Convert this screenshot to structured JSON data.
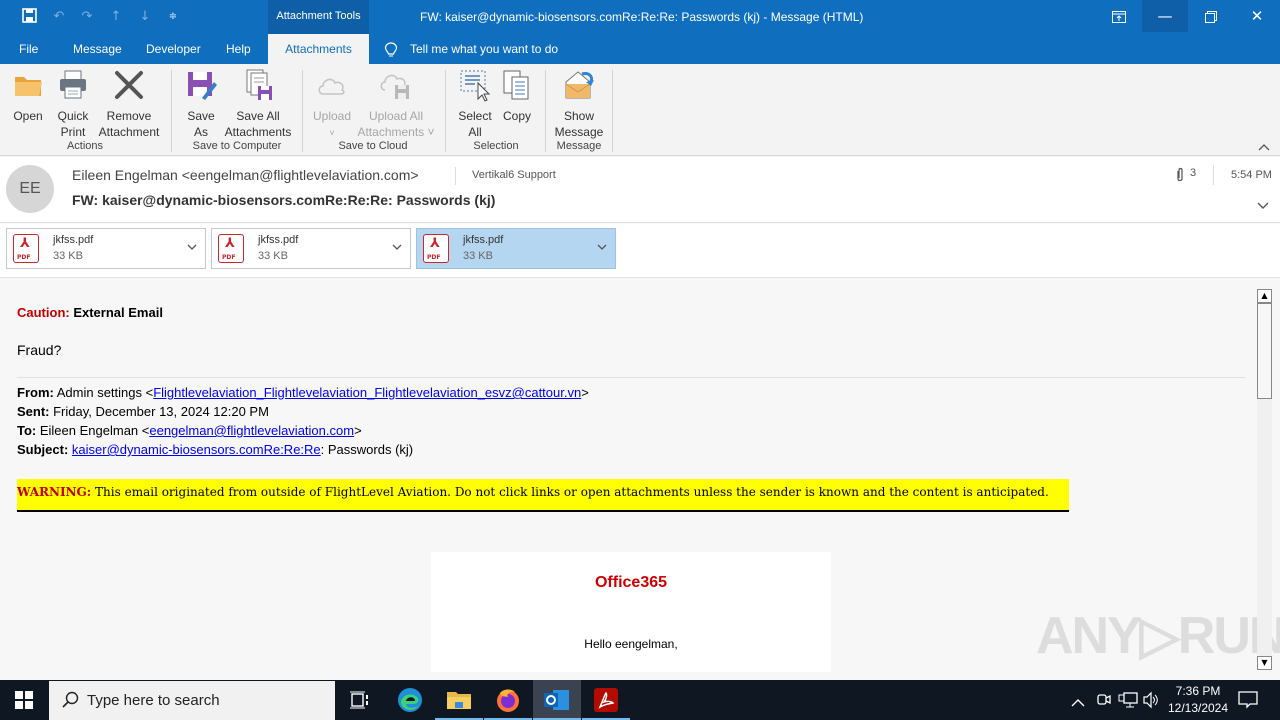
{
  "titlebar": {
    "context_tab_group": "Attachment Tools",
    "window_title": "FW: kaiser@dynamic-biosensors.comRe:Re:Re:  Passwords   (kj)  -  Message (HTML)",
    "quick_access": [
      "save-icon",
      "undo-icon",
      "redo-icon",
      "up-icon",
      "down-icon",
      "customize-icon"
    ]
  },
  "menu": {
    "tabs": [
      "File",
      "Message",
      "Developer",
      "Help",
      "Attachments"
    ],
    "active_tab": "Attachments",
    "tell_me": "Tell me what you want to do"
  },
  "ribbon": {
    "groups": [
      {
        "label": "Actions",
        "buttons": [
          {
            "line1": "Open",
            "line2": ""
          },
          {
            "line1": "Quick",
            "line2": "Print"
          },
          {
            "line1": "Remove",
            "line2": "Attachment"
          }
        ]
      },
      {
        "label": "Save to Computer",
        "buttons": [
          {
            "line1": "Save",
            "line2": "As"
          },
          {
            "line1": "Save All",
            "line2": "Attachments"
          }
        ]
      },
      {
        "label": "Save to Cloud",
        "buttons": [
          {
            "line1": "Upload",
            "line2": "˅"
          },
          {
            "line1": "Upload All",
            "line2": "Attachments ˅"
          }
        ]
      },
      {
        "label": "Selection",
        "buttons": [
          {
            "line1": "Select",
            "line2": "All"
          },
          {
            "line1": "Copy",
            "line2": ""
          }
        ]
      },
      {
        "label": "Message",
        "buttons": [
          {
            "line1": "Show",
            "line2": "Message"
          }
        ]
      }
    ]
  },
  "header": {
    "avatar_initials": "EE",
    "sender": "Eileen Engelman <eengelman@flightlevelaviation.com>",
    "recipient": "Vertikal6 Support",
    "subject": "FW: kaiser@dynamic-biosensors.comRe:Re:Re:  Passwords   (kj)",
    "attachment_count": "3",
    "time": "5:54 PM"
  },
  "attachments": [
    {
      "name": "jkfss.pdf",
      "size": "33 KB",
      "selected": false
    },
    {
      "name": "jkfss.pdf",
      "size": "33 KB",
      "selected": false
    },
    {
      "name": "jkfss.pdf",
      "size": "33 KB",
      "selected": true
    }
  ],
  "body": {
    "caution_label": "Caution:",
    "caution_text": " External Email",
    "intro": "Fraud?",
    "from_label": "From:",
    "from_name": " Admin settings <",
    "from_email": "Flightlevelaviation_Flightlevelaviation_Flightlevelaviation_esvz@cattour.vn",
    "from_close": ">",
    "sent_label": "Sent:",
    "sent_value": " Friday, December 13, 2024 12:20 PM",
    "to_label": "To:",
    "to_name": " Eileen Engelman <",
    "to_email": "eengelman@flightlevelaviation.com",
    "to_close": ">",
    "subject_label": "Subject:",
    "subject_link": "kaiser@dynamic-biosensors.comRe:Re:Re",
    "subject_rest": ": Passwords (kj)",
    "warning_label": "WARNING:",
    "warning_text": " This email originated from outside of FlightLevel Aviation. Do not click links or open attachments unless the sender is known and the content is anticipated.",
    "card_brand": "Office365",
    "card_greeting": "Hello eengelman,"
  },
  "watermark": "ANY▷RUN",
  "taskbar": {
    "search_placeholder": "Type here to search",
    "apps": [
      "task-view",
      "edge",
      "file-explorer",
      "firefox",
      "outlook",
      "acrobat"
    ],
    "active_app": "outlook",
    "clock_time": "7:36 PM",
    "clock_date": "12/13/2024"
  },
  "colors": {
    "titlebar": "#106ebe",
    "accent_red": "#c00000",
    "warning_bg": "#ffff00",
    "selected_attachment": "#b4d6f0"
  }
}
